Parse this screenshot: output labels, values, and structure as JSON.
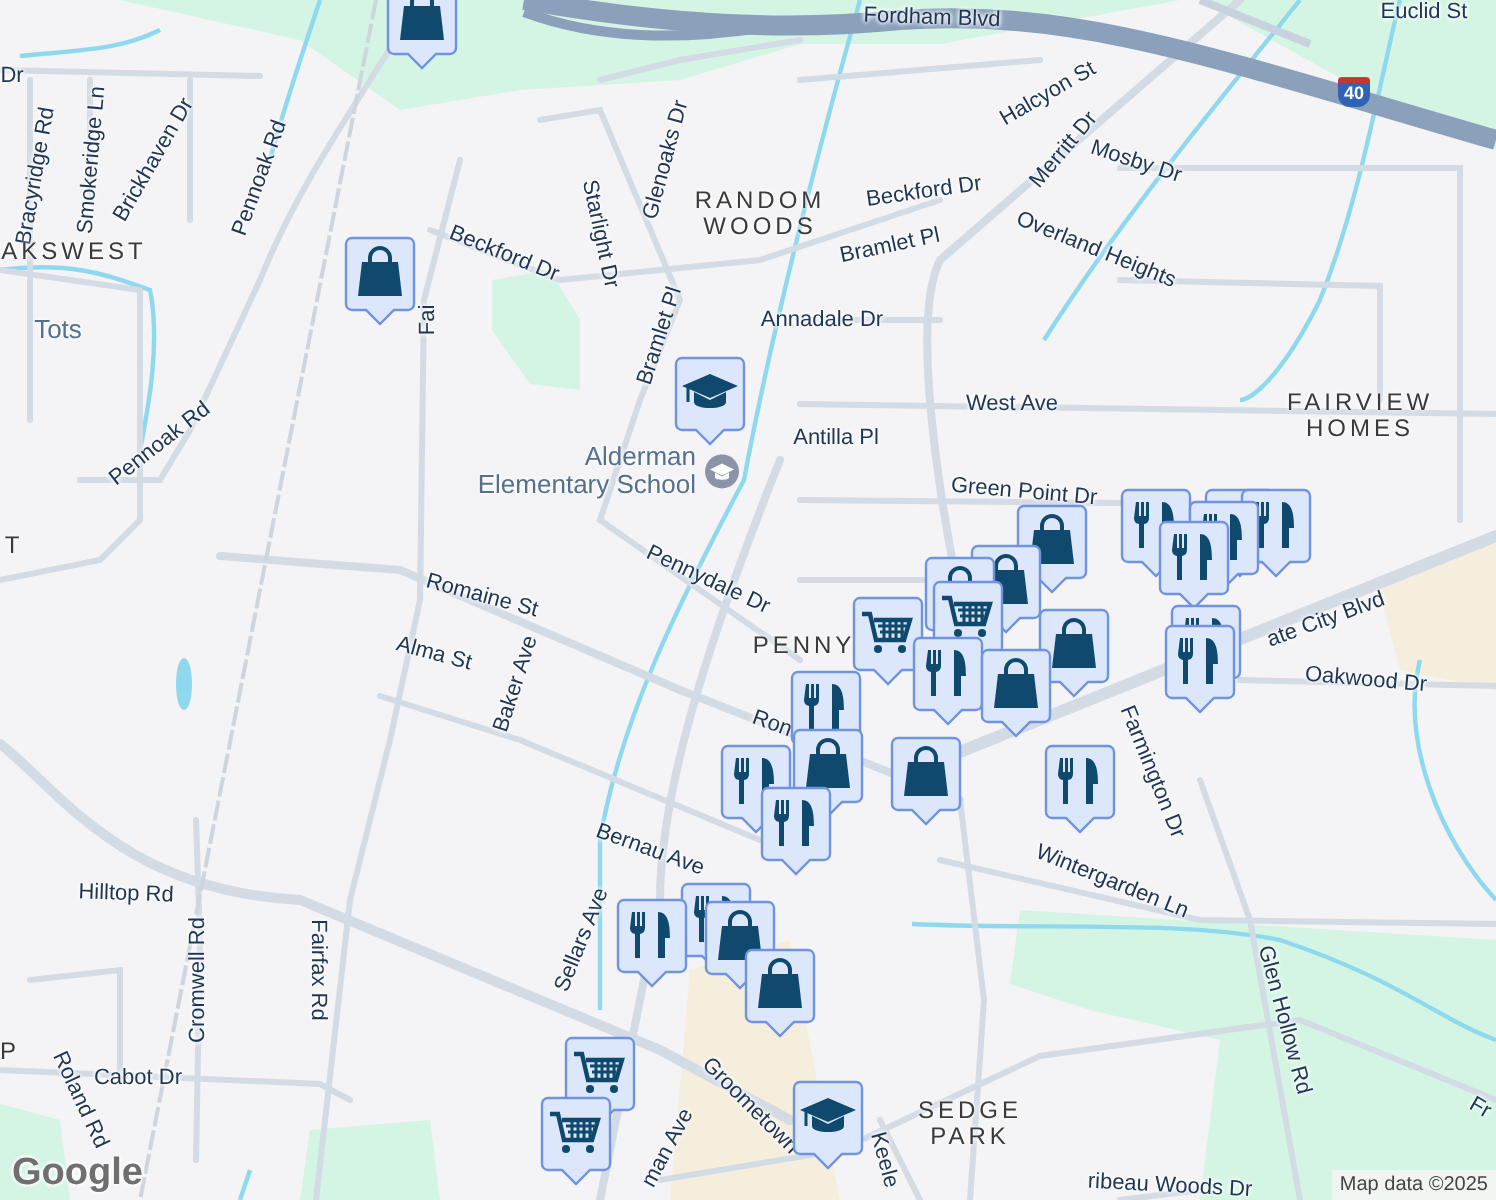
{
  "map": {
    "labels": [
      {
        "text": "Fordham Blvd",
        "kind": "road"
      },
      {
        "text": "Euclid St",
        "kind": "road"
      },
      {
        "text": "Halcyon St",
        "kind": "road"
      },
      {
        "text": "Merritt Dr",
        "kind": "road"
      },
      {
        "text": "Mosby Dr",
        "kind": "road"
      },
      {
        "text": "Beckford Dr",
        "kind": "road"
      },
      {
        "text": "RANDOM WOODS",
        "kind": "area"
      },
      {
        "text": "Bramlet Pl",
        "kind": "road"
      },
      {
        "text": "Overland Heights",
        "kind": "road"
      },
      {
        "text": "Annadale Dr",
        "kind": "road"
      },
      {
        "text": "West Ave",
        "kind": "road"
      },
      {
        "text": "FAIRVIEW HOMES",
        "kind": "area"
      },
      {
        "text": "Antilla Pl",
        "kind": "road"
      },
      {
        "text": "Green Point Dr",
        "kind": "road"
      },
      {
        "text": "Dr",
        "kind": "road"
      },
      {
        "text": "Bracyridge Rd",
        "kind": "road"
      },
      {
        "text": "Smokeridge Ln",
        "kind": "road"
      },
      {
        "text": "Brickhaven Dr",
        "kind": "road"
      },
      {
        "text": "Pennoak Rd",
        "kind": "road"
      },
      {
        "text": "AKSWEST",
        "kind": "area"
      },
      {
        "text": "Tots",
        "kind": "place"
      },
      {
        "text": "Pennoak Rd",
        "kind": "road"
      },
      {
        "text": "T",
        "kind": "area"
      },
      {
        "text": "Beckford Dr",
        "kind": "road"
      },
      {
        "text": "Fai",
        "kind": "road"
      },
      {
        "text": "Starlight Dr",
        "kind": "road"
      },
      {
        "text": "Glenoaks Dr",
        "kind": "road"
      },
      {
        "text": "Bramlet Pl",
        "kind": "road"
      },
      {
        "text": "Alderman Elementary School",
        "kind": "school"
      },
      {
        "text": "Pennydale Dr",
        "kind": "road"
      },
      {
        "text": "Romaine St",
        "kind": "road"
      },
      {
        "text": "Alma St",
        "kind": "road"
      },
      {
        "text": "Baker Ave",
        "kind": "road"
      },
      {
        "text": "PENNY",
        "kind": "area"
      },
      {
        "text": "Ron",
        "kind": "road"
      },
      {
        "text": "Bernau Ave",
        "kind": "road"
      },
      {
        "text": "Hilltop Rd",
        "kind": "road"
      },
      {
        "text": "Cromwell Rd",
        "kind": "road"
      },
      {
        "text": "Fairfax Rd",
        "kind": "road"
      },
      {
        "text": "Sellars Ave",
        "kind": "road"
      },
      {
        "text": "P",
        "kind": "area"
      },
      {
        "text": "Cabot Dr",
        "kind": "road"
      },
      {
        "text": "Roland Rd",
        "kind": "road"
      },
      {
        "text": "Groometown",
        "kind": "road"
      },
      {
        "text": "man Ave",
        "kind": "road"
      },
      {
        "text": "ate City Blvd",
        "kind": "road"
      },
      {
        "text": "Oakwood Dr",
        "kind": "road"
      },
      {
        "text": "Farmington Dr",
        "kind": "road"
      },
      {
        "text": "Wintergarden Ln",
        "kind": "road"
      },
      {
        "text": "Glen Hollow Rd",
        "kind": "road"
      },
      {
        "text": "Fr",
        "kind": "road"
      },
      {
        "text": "SEDGE PARK",
        "kind": "area"
      },
      {
        "text": "Keele",
        "kind": "road"
      },
      {
        "text": "ribeau Woods Dr",
        "kind": "road"
      },
      {
        "text": "40",
        "kind": "shield"
      }
    ],
    "pins": [
      {
        "kind": "shopping"
      },
      {
        "kind": "shopping"
      },
      {
        "kind": "school"
      },
      {
        "kind": "restaurant"
      },
      {
        "kind": "restaurant"
      },
      {
        "kind": "restaurant"
      },
      {
        "kind": "restaurant"
      },
      {
        "kind": "restaurant"
      },
      {
        "kind": "shopping"
      },
      {
        "kind": "shopping"
      },
      {
        "kind": "shopping"
      },
      {
        "kind": "grocery"
      },
      {
        "kind": "grocery"
      },
      {
        "kind": "restaurant"
      },
      {
        "kind": "restaurant"
      },
      {
        "kind": "shopping"
      },
      {
        "kind": "restaurant"
      },
      {
        "kind": "shopping"
      },
      {
        "kind": "restaurant"
      },
      {
        "kind": "shopping"
      },
      {
        "kind": "shopping"
      },
      {
        "kind": "restaurant"
      },
      {
        "kind": "restaurant"
      },
      {
        "kind": "restaurant"
      },
      {
        "kind": "restaurant"
      },
      {
        "kind": "restaurant"
      },
      {
        "kind": "shopping"
      },
      {
        "kind": "shopping"
      },
      {
        "kind": "grocery"
      },
      {
        "kind": "grocery"
      },
      {
        "kind": "school"
      }
    ]
  },
  "logo": "Google",
  "attribution": "Map data ©2025"
}
